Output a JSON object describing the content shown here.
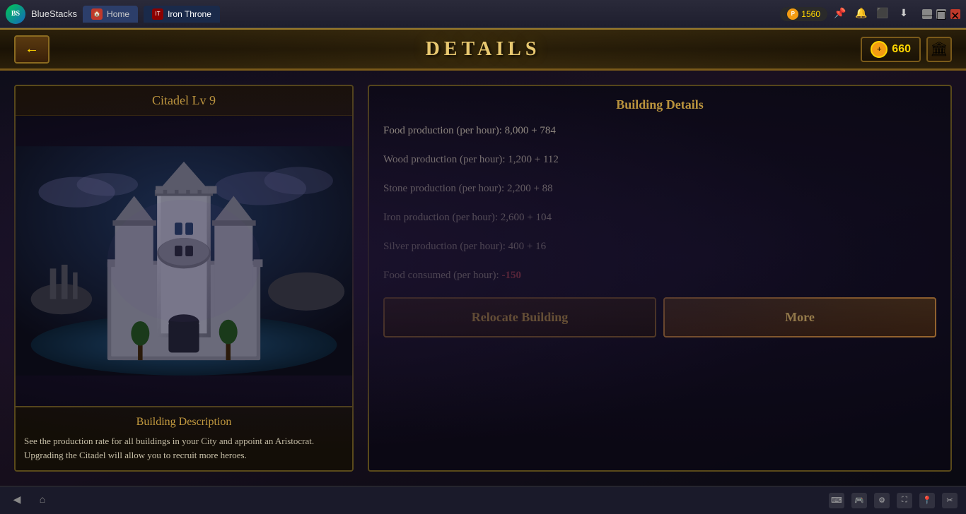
{
  "titlebar": {
    "brand": "BlueStacks",
    "tab_home": "Home",
    "tab_game": "Iron Throne",
    "points": "1560",
    "points_label": "P"
  },
  "header": {
    "title": "DETAILS",
    "back_label": "←",
    "currency_amount": "660"
  },
  "left_panel": {
    "building_name": "Citadel Lv 9",
    "desc_section_title": "Building Description",
    "desc_text": "See the production rate for all buildings in your City and appoint an Aristocrat. Upgrading the Citadel will allow you to recruit more heroes."
  },
  "right_panel": {
    "section_title": "Building Details",
    "stats": [
      {
        "label": "Food production (per hour): 8,000 + 784",
        "negative": false
      },
      {
        "label": "Wood production (per hour): 1,200 + 112",
        "negative": false
      },
      {
        "label": "Stone production (per hour): 2,200 + 88",
        "negative": false
      },
      {
        "label": "Iron production (per hour): 2,600 + 104",
        "negative": false
      },
      {
        "label": "Silver production (per hour): 400 + 16",
        "negative": false
      },
      {
        "label": "Food consumed (per hour): ",
        "value": "-150",
        "negative": true
      }
    ],
    "btn_relocate": "Relocate Building",
    "btn_more": "More"
  }
}
